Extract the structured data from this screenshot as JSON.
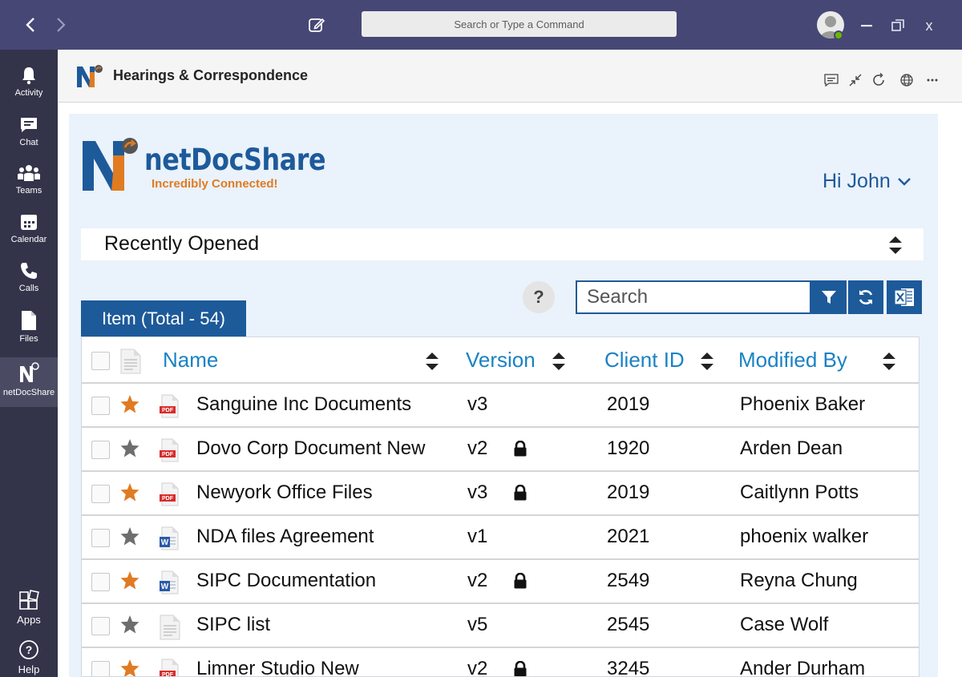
{
  "titlebar": {
    "command_placeholder": "Search or Type a Command",
    "minimize": "—",
    "maximize": "❐",
    "close": "x"
  },
  "rail": {
    "items": [
      {
        "label": "Activity",
        "icon": "bell-icon"
      },
      {
        "label": "Chat",
        "icon": "chat-icon"
      },
      {
        "label": "Teams",
        "icon": "teams-icon"
      },
      {
        "label": "Calendar",
        "icon": "calendar-icon"
      },
      {
        "label": "Calls",
        "icon": "phone-icon"
      },
      {
        "label": "Files",
        "icon": "file-icon"
      },
      {
        "label": "netDocShare",
        "icon": "netdocshare-icon",
        "active": true
      }
    ],
    "bottom": [
      {
        "label": "Apps",
        "icon": "apps-icon"
      },
      {
        "label": "Help",
        "icon": "help-icon"
      }
    ]
  },
  "appbar": {
    "title": "Hearings & Correspondence"
  },
  "brand": {
    "name": "netDocShare",
    "tagline": "Incredibly Connected!"
  },
  "greeting": "Hi John",
  "view": {
    "selected": "Recently Opened"
  },
  "help_label": "?",
  "search": {
    "placeholder": "Search"
  },
  "total_label": "Item (Total - 54)",
  "table": {
    "columns": [
      "Name",
      "Version",
      "Client ID",
      "Modified By"
    ],
    "rows": [
      {
        "name": "Sanguine Inc Documents",
        "version": "v3",
        "client_id": "2019",
        "modified_by": "Phoenix Baker",
        "starred": true,
        "type": "pdf",
        "locked": false
      },
      {
        "name": "Dovo Corp Document New",
        "version": "v2",
        "client_id": "1920",
        "modified_by": "Arden Dean",
        "starred": false,
        "type": "pdf",
        "locked": true
      },
      {
        "name": "Newyork Office Files",
        "version": "v3",
        "client_id": "2019",
        "modified_by": "Caitlynn Potts",
        "starred": true,
        "type": "pdf",
        "locked": true
      },
      {
        "name": "NDA files Agreement",
        "version": "v1",
        "client_id": "2021",
        "modified_by": "phoenix walker",
        "starred": false,
        "type": "word",
        "locked": false
      },
      {
        "name": "SIPC Documentation",
        "version": "v2",
        "client_id": "2549",
        "modified_by": "Reyna Chung",
        "starred": true,
        "type": "word",
        "locked": true
      },
      {
        "name": "SIPC list",
        "version": "v5",
        "client_id": "2545",
        "modified_by": "Case Wolf",
        "starred": false,
        "type": "generic",
        "locked": false
      },
      {
        "name": "Limner Studio New",
        "version": "v2",
        "client_id": "3245",
        "modified_by": "Ander Durham",
        "starred": true,
        "type": "pdf",
        "locked": true
      }
    ]
  },
  "colors": {
    "titlebar": "#464775",
    "rail": "#33344a",
    "brand_blue": "#1d5a9a",
    "link_blue": "#1a82c4",
    "star_orange": "#e07b22",
    "star_gray": "#6e6e6e"
  }
}
